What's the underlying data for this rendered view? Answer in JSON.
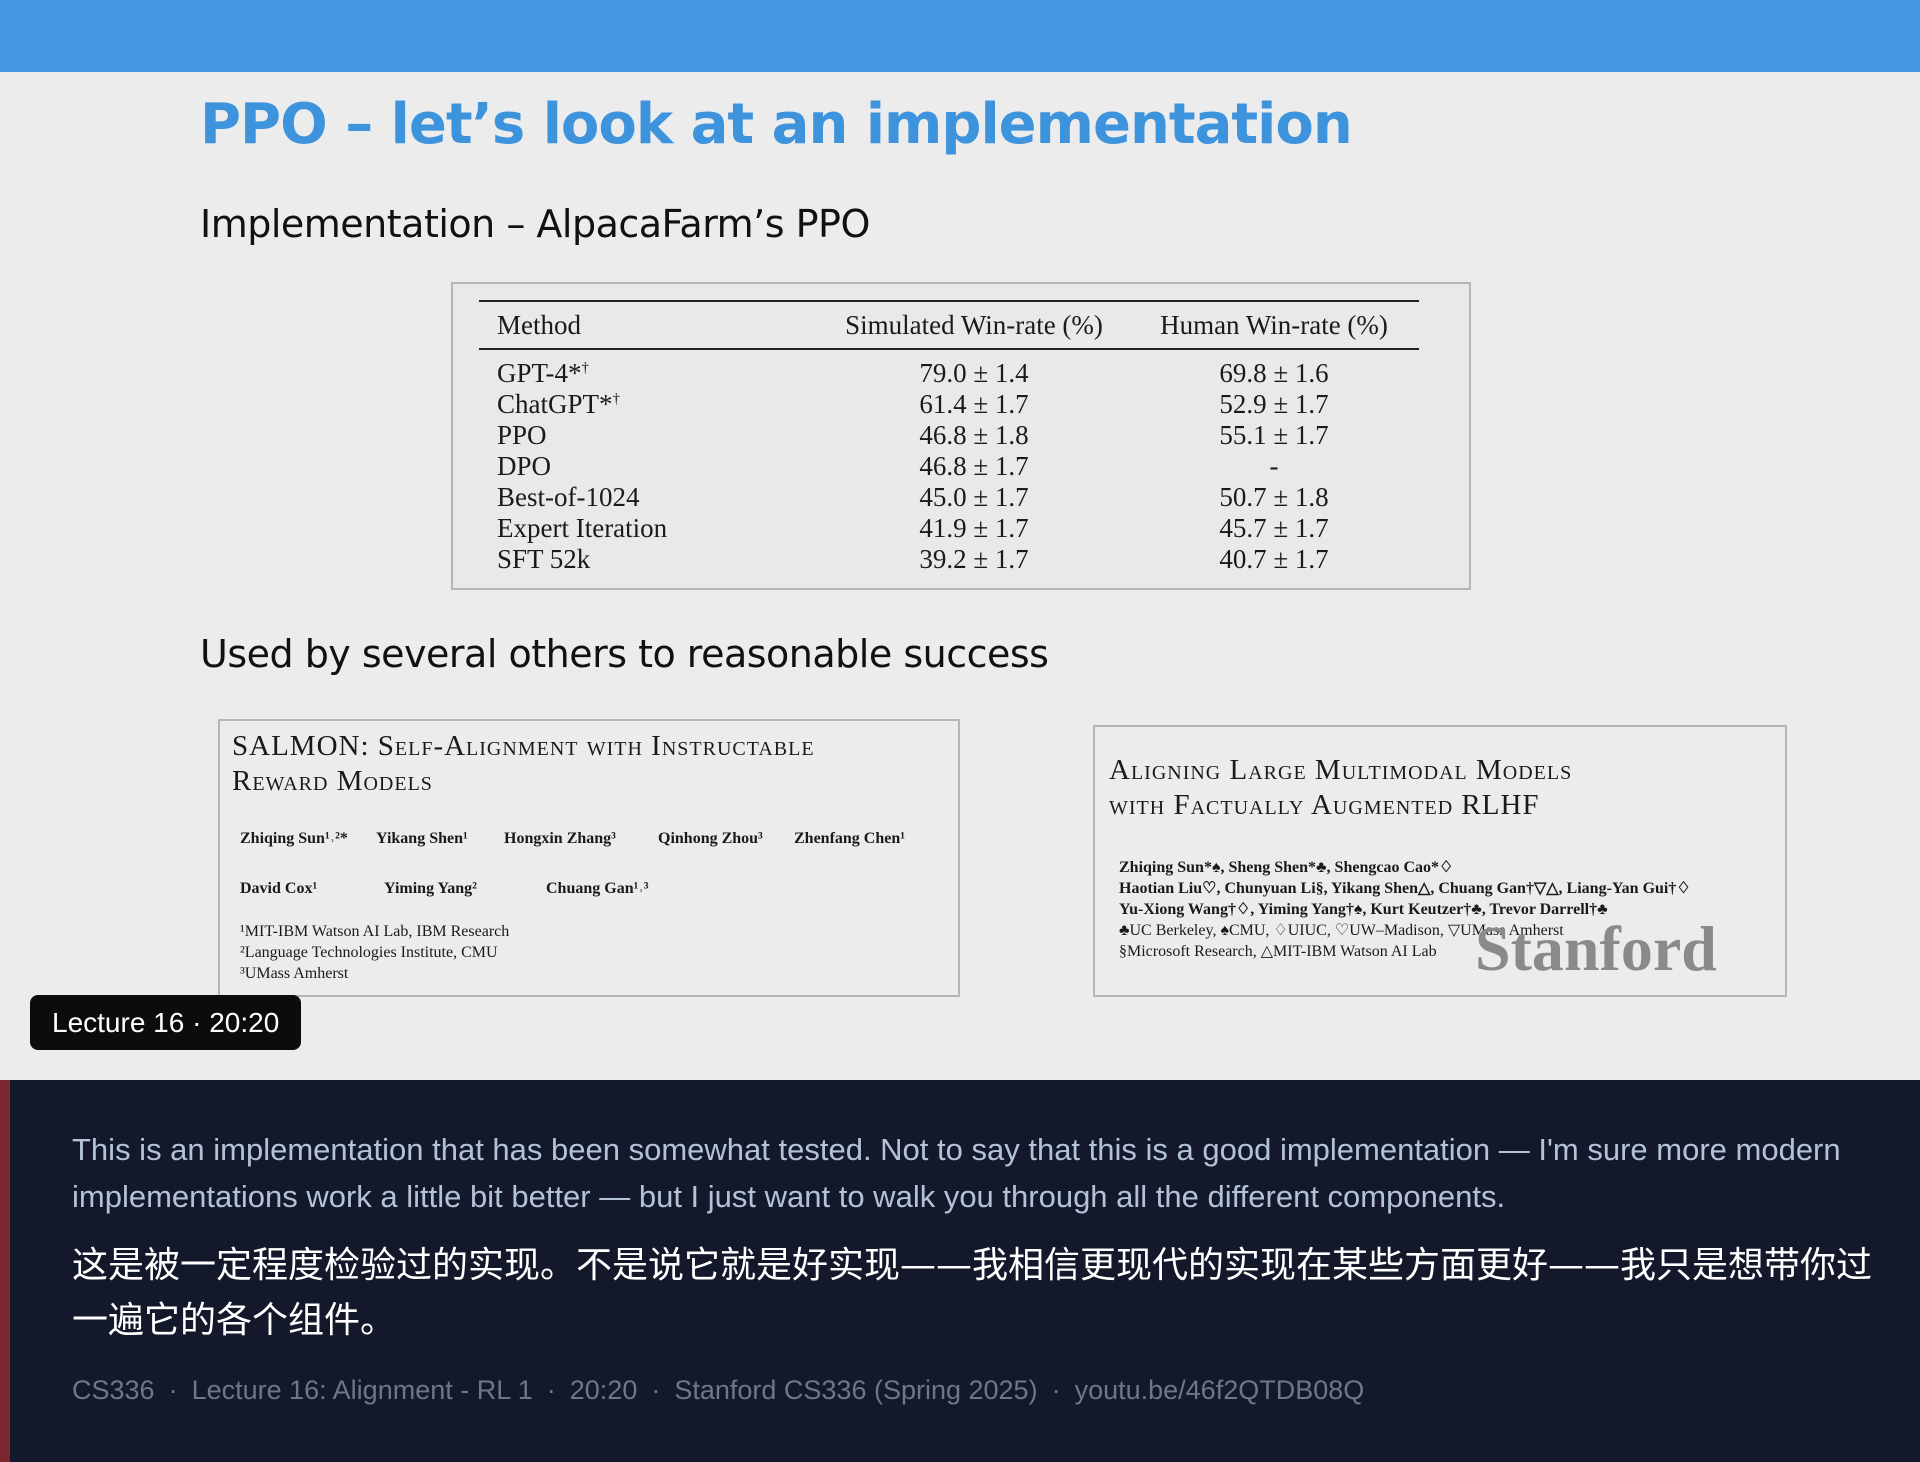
{
  "slide": {
    "title": "PPO – let’s look at an implementation",
    "subheading1": "Implementation – AlpacaFarm’s PPO",
    "subheading2": "Used by several others to reasonable success",
    "table": {
      "headers": [
        "Method",
        "Simulated Win-rate (%)",
        "Human Win-rate (%)"
      ],
      "rows": [
        {
          "method": "GPT-4*",
          "sup": "†",
          "sim": "79.0 ± 1.4",
          "human": "69.8 ± 1.6"
        },
        {
          "method": "ChatGPT*",
          "sup": "†",
          "sim": "61.4 ± 1.7",
          "human": "52.9 ± 1.7"
        },
        {
          "method": "PPO",
          "sup": "",
          "sim": "46.8 ± 1.8",
          "human": "55.1 ± 1.7"
        },
        {
          "method": "DPO",
          "sup": "",
          "sim": "46.8 ± 1.7",
          "human": "-"
        },
        {
          "method": "Best-of-1024",
          "sup": "",
          "sim": "45.0 ± 1.7",
          "human": "50.7 ± 1.8"
        },
        {
          "method": "Expert Iteration",
          "sup": "",
          "sim": "41.9 ± 1.7",
          "human": "45.7 ± 1.7"
        },
        {
          "method": "SFT 52k",
          "sup": "",
          "sim": "39.2 ± 1.7",
          "human": "40.7 ± 1.7"
        }
      ]
    },
    "paper1": {
      "title_line1": "SALMON: Self-Alignment with Instructable",
      "title_line2": "Reward Models",
      "authors_row1": [
        "Zhiqing Sun¹˒²*",
        "Yikang Shen¹",
        "Hongxin Zhang³",
        "Qinhong Zhou³",
        "Zhenfang Chen¹"
      ],
      "authors_row2": [
        "David Cox¹",
        "Yiming Yang²",
        "Chuang Gan¹˒³"
      ],
      "affiliations": [
        "¹MIT-IBM Watson AI Lab, IBM Research",
        "²Language Technologies Institute, CMU",
        "³UMass Amherst"
      ]
    },
    "paper2": {
      "title_line1": "Aligning Large Multimodal Models",
      "title_line2": "with Factually Augmented RLHF",
      "authors": [
        "Zhiqing Sun*♠, Sheng Shen*♣, Shengcao Cao*♢",
        "Haotian Liu♡, Chunyuan Li§, Yikang Shen△, Chuang Gan†▽△, Liang-Yan Gui†♢",
        "Yu-Xiong Wang†♢, Yiming Yang†♠, Kurt Keutzer†♣, Trevor Darrell†♣"
      ],
      "affiliations": [
        "♣UC Berkeley, ♠CMU, ♢UIUC, ♡UW–Madison, ▽UMass Amherst",
        "§Microsoft Research, △MIT-IBM Watson AI Lab"
      ]
    },
    "watermark": "Stanford"
  },
  "badge": "Lecture 16 · 20:20",
  "caption": {
    "english": "This is an implementation that has been somewhat tested. Not to say that this is a good implementation — I'm sure more modern implementations work a little bit better — but I just want to walk you through all the different components.",
    "chinese": "这是被一定程度检验过的实现。不是说它就是好实现——我相信更现代的实现在某些方面更好——我只是想带你过一遍它的各个组件。",
    "meta": [
      "CS336",
      "Lecture 16: Alignment - RL 1",
      "20:20",
      "Stanford CS336 (Spring 2025)",
      "youtu.be/46f2QTDB08Q"
    ],
    "separator": "·"
  },
  "colors": {
    "topbar": "#4397e2",
    "title": "#3e93dd",
    "caption_bg": "#13192a",
    "caption_accent": "#7a2730",
    "caption_english": "#b3c2d6",
    "caption_chinese": "#ffffff"
  }
}
